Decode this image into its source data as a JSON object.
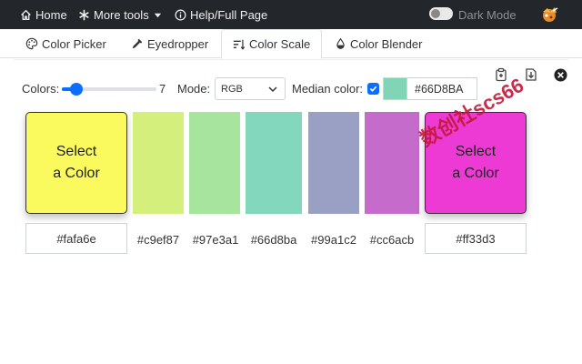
{
  "topbar": {
    "home_label": "Home",
    "more_tools_label": "More tools",
    "help_label": "Help/Full Page",
    "dark_mode_label": "Dark Mode",
    "dark_mode_on": false
  },
  "tabs": [
    {
      "label": "Color Picker",
      "icon": "palette-icon"
    },
    {
      "label": "Eyedropper",
      "icon": "eyedropper-icon"
    },
    {
      "label": "Color Scale",
      "icon": "sort-lines-icon",
      "active": true
    },
    {
      "label": "Color Blender",
      "icon": "droplet-icon"
    }
  ],
  "controls": {
    "colors_label": "Colors:",
    "colors_value": "7",
    "colors_fraction": 0.1,
    "mode_label": "Mode:",
    "mode_value": "RGB",
    "median_label": "Median color:",
    "median_checked": true,
    "median_value": "#66D8BA",
    "median_color": "#7fd5b5"
  },
  "scale": {
    "start": {
      "text": "Select\na Color",
      "hex": "#fafa6e",
      "color": "#fafa5e"
    },
    "end": {
      "text": "Select\na Color",
      "hex": "#ff33d3",
      "color": "#ee3ad4"
    },
    "steps": [
      {
        "hex": "#c9ef87",
        "color": "#d4ef7c"
      },
      {
        "hex": "#97e3a1",
        "color": "#a7e59f"
      },
      {
        "hex": "#66d8ba",
        "color": "#83d7bc"
      },
      {
        "hex": "#99a1c2",
        "color": "#9aa0c4"
      },
      {
        "hex": "#cc6acb",
        "color": "#c46bcc"
      }
    ]
  },
  "watermark": "数创社scs66"
}
